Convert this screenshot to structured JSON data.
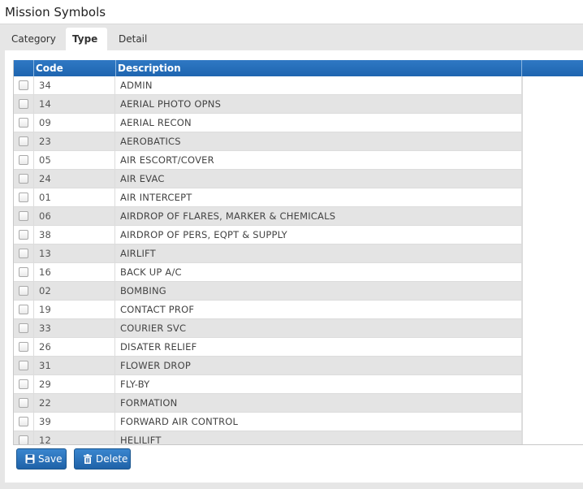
{
  "window": {
    "title": "Mission Symbols"
  },
  "tabs": [
    {
      "label": "Category",
      "active": false
    },
    {
      "label": "Type",
      "active": true
    },
    {
      "label": "Detail",
      "active": false
    }
  ],
  "grid": {
    "columns": [
      "Code",
      "Description"
    ],
    "rows": [
      {
        "code": "34",
        "description": "ADMIN"
      },
      {
        "code": "14",
        "description": "AERIAL PHOTO OPNS"
      },
      {
        "code": "09",
        "description": "AERIAL RECON"
      },
      {
        "code": "23",
        "description": "AEROBATICS"
      },
      {
        "code": "05",
        "description": "AIR ESCORT/COVER"
      },
      {
        "code": "24",
        "description": "AIR EVAC"
      },
      {
        "code": "01",
        "description": "AIR INTERCEPT"
      },
      {
        "code": "06",
        "description": "AIRDROP OF FLARES, MARKER & CHEMICALS"
      },
      {
        "code": "38",
        "description": "AIRDROP OF PERS, EQPT & SUPPLY"
      },
      {
        "code": "13",
        "description": "AIRLIFT"
      },
      {
        "code": "16",
        "description": "BACK UP A/C"
      },
      {
        "code": "02",
        "description": "BOMBING"
      },
      {
        "code": "19",
        "description": "CONTACT PROF"
      },
      {
        "code": "33",
        "description": "COURIER SVC"
      },
      {
        "code": "26",
        "description": "DISATER RELIEF"
      },
      {
        "code": "31",
        "description": "FLOWER DROP"
      },
      {
        "code": "29",
        "description": "FLY-BY"
      },
      {
        "code": "22",
        "description": "FORMATION"
      },
      {
        "code": "39",
        "description": "FORWARD AIR CONTROL"
      },
      {
        "code": "12",
        "description": "HELILIFT"
      }
    ]
  },
  "footer": {
    "save_label": "Save",
    "delete_label": "Delete",
    "save_icon": "floppy-disk-icon",
    "delete_icon": "trash-icon"
  },
  "colors": {
    "header_blue": "#1e65b0",
    "button_blue": "#2a74bd",
    "row_alt": "#e4e4e4"
  }
}
